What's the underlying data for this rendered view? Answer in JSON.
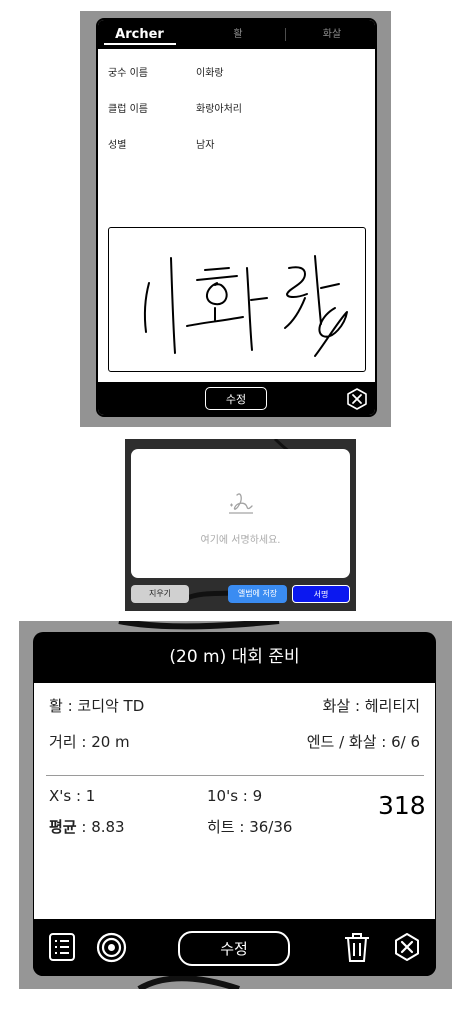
{
  "archer_panel": {
    "tabs": [
      "Archer",
      "활",
      "화살"
    ],
    "fields": [
      {
        "label": "궁수 이름",
        "value": "이화랑"
      },
      {
        "label": "클럽 이름",
        "value": "화랑아처리"
      },
      {
        "label": "성별",
        "value": "남자"
      }
    ],
    "signature_text": "이화랑",
    "edit_label": "수정"
  },
  "signature_pad": {
    "hint": "여기에 서명하세요.",
    "clear_label": "지우기",
    "save_album_label": "앨범에 저장",
    "sign_label": "서명"
  },
  "competition_panel": {
    "title": "(20 m) 대회 준비",
    "bow": "활 : 코디악 TD",
    "arrow": "화살 : 헤리티지",
    "distance": "거리 : 20 m",
    "ends": "엔드 / 화살 :  6/ 6",
    "xs": "X's : 1",
    "tens": "10's : 9",
    "average_label": "평균",
    "average_value": " : 8.83",
    "hits": "히트 : 36/36",
    "total": "318",
    "edit_label": "수정"
  },
  "icons": [
    "list-icon",
    "target-icon",
    "trash-icon",
    "close-icon"
  ],
  "colors": {
    "accent_blue": "#3a8cf2",
    "sign_blue": "#0b18f0"
  }
}
